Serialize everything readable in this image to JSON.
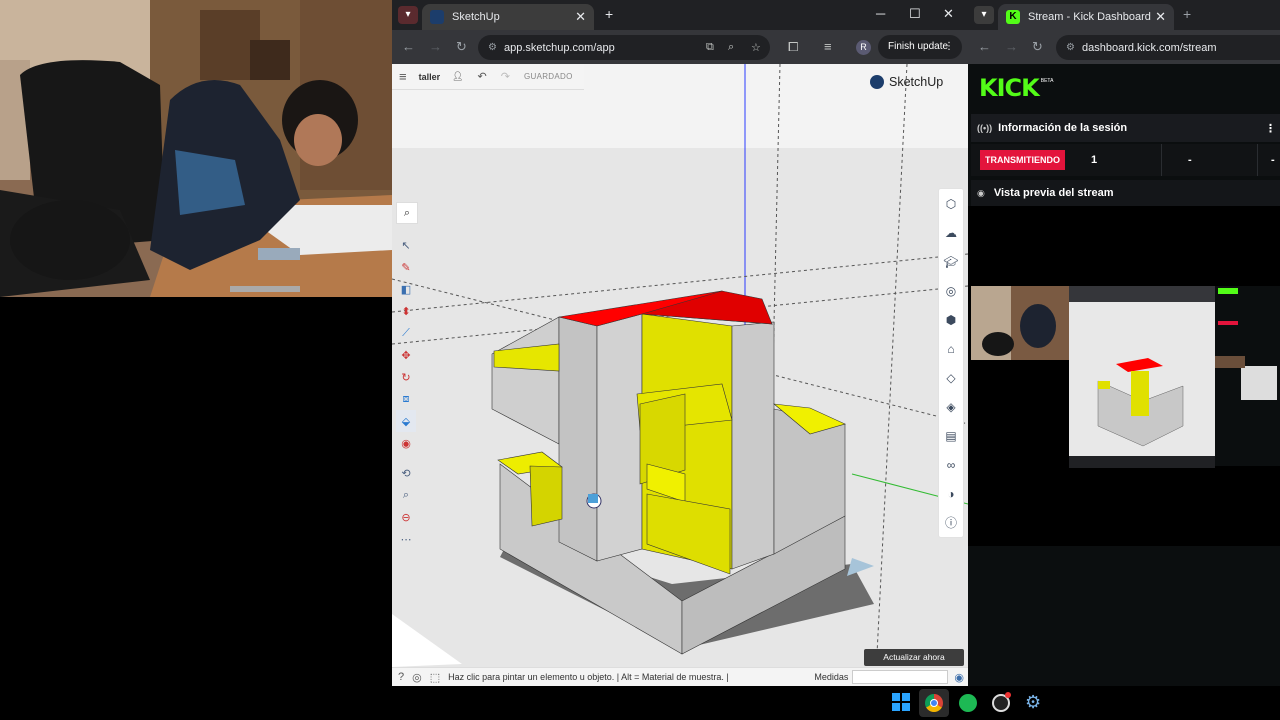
{
  "sketchup_window": {
    "tab_title": "SketchUp",
    "url": "app.sketchup.com/app",
    "profile_initial": "R",
    "finish_update_label": "Finish update",
    "toolbar": {
      "workspace_name": "taller",
      "save_status": "GUARDADO"
    },
    "brand": "SketchUp",
    "status_text": "Haz clic para pintar un elemento u objeto. | Alt = Material de muestra. |",
    "measurements_label": "Medidas",
    "measurements_value": "",
    "update_now_label": "Actualizar ahora",
    "left_tools": [
      "search-icon",
      "select-icon",
      "pencil-icon",
      "eraser-icon",
      "push-pull-icon",
      "line-icon",
      "move-icon",
      "rotate-icon",
      "scale-icon",
      "paint-bucket-icon",
      "orbit-icon",
      "walk-icon",
      "zoom-icon",
      "section-icon",
      "more-icon"
    ],
    "right_panels": [
      "entity-info-icon",
      "materials-icon",
      "styles-icon",
      "components-icon",
      "outliner-icon",
      "scenes-icon",
      "soften-icon",
      "layers-icon",
      "display-icon",
      "glasses-icon",
      "shadows-icon",
      "info-icon"
    ],
    "colors": {
      "red_face": "#ff0000",
      "yellow_face": "#e0e000",
      "gray_face": "#c8c8c8"
    }
  },
  "kick_window": {
    "tab_title": "Stream - Kick Dashboard",
    "url": "dashboard.kick.com/stream",
    "logo": "KICK",
    "logo_badge": "BETA",
    "session_header": "Información de la sesión",
    "status_badge": "TRANSMITIENDO",
    "stat_1": "1",
    "stat_2": "-",
    "stat_3": "-",
    "preview_header": "Vista previa del stream",
    "brand_color": "#53fc18",
    "badge_color": "#e3143c"
  },
  "taskbar": {
    "icons": [
      "windows-start-icon",
      "chrome-icon",
      "spotify-icon",
      "obs-icon",
      "settings-icon"
    ]
  }
}
